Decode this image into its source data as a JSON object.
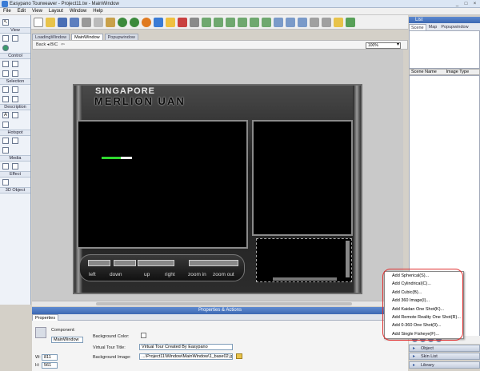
{
  "titlebar": {
    "title": "Easypano Tourweaver - Project11.tw - MainWindow",
    "btn_min": "_",
    "btn_max": "□",
    "btn_close": "×"
  },
  "menu": [
    "File",
    "Edit",
    "View",
    "Layout",
    "Window",
    "Help"
  ],
  "toolpanel": {
    "sections": [
      "View",
      "Control",
      "Selection",
      "Description",
      "Hotspot",
      "Media",
      "Effect",
      "3D Object"
    ],
    "text_tool_glyph": "A"
  },
  "doc_tabs": [
    "LoadingWindow",
    "MainWindow",
    "Popupwindow"
  ],
  "doc_toolbar": {
    "back_label": "Back ◂ BIC",
    "zoom": "100%"
  },
  "skin": {
    "title_line1": "SINGAPORE",
    "title_line2": "MERLION UAN",
    "nav_labels": [
      "left",
      "down",
      "up",
      "right",
      "zoom in",
      "zoom out"
    ]
  },
  "properties": {
    "header": "Properties & Actions",
    "tab": "Properties",
    "component_label": "Component:",
    "component_value": "MainWindow",
    "w_label": "W:",
    "w_value": "811",
    "h_label": "H:",
    "h_value": "561",
    "bg_color_label": "Background Color:",
    "tour_title_label": "Virtual Tour Title:",
    "tour_title_value": "Virtual Tour Created By Easypano",
    "bg_image_label": "Background Image:",
    "bg_image_value": "...\\Project11\\Window\\MainWindow\\1_base02.jpg"
  },
  "right_panel": {
    "header": "List",
    "tabs": [
      "Scene",
      "Map",
      "Popupwindow"
    ],
    "columns": [
      "Scene Name",
      "Image Type"
    ],
    "groups": [
      "Object",
      "Skin List",
      "Library"
    ]
  },
  "context_menu": [
    "Add Spherical(S)...",
    "Add Cylindrical(C)...",
    "Add Cubic(B)...",
    "Add 360 Image(I)...",
    "Add Kaidan One Shot(K)...",
    "Add Remote Reality One Shot(R)...",
    "Add 0-360 One Shot(0)...",
    "Add Single Fisheye(F)..."
  ],
  "colors": {
    "accent": "#3c68b3",
    "highlight_ring": "#e03030",
    "progress": "#2fd82f"
  }
}
